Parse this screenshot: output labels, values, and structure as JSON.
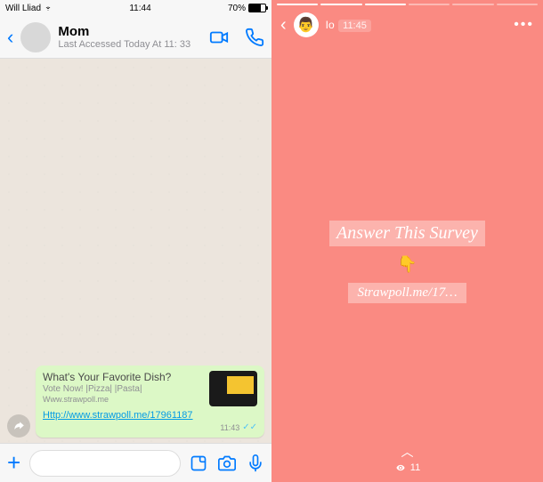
{
  "left": {
    "statusbar": {
      "carrier": "Will Lliad",
      "time": "11:44",
      "battery_pct": "70%"
    },
    "header": {
      "contact_name": "Mom",
      "last_seen": "Last Accessed Today At 11: 33"
    },
    "message": {
      "preview_title": "What's Your Favorite Dish?",
      "preview_sub": "Vote Now! |Pizza| |Pasta|",
      "preview_domain": "Www.strawpoll.me",
      "link": "Http://www.strawpoll.me/17961187",
      "time": "11:43"
    }
  },
  "right": {
    "header": {
      "name": "Io",
      "time": "11:45",
      "menu": "•••"
    },
    "content": {
      "title": "Answer This Survey",
      "emoji": "👇",
      "link": "Strawpoll.me/17…"
    },
    "footer": {
      "views": "11"
    }
  }
}
